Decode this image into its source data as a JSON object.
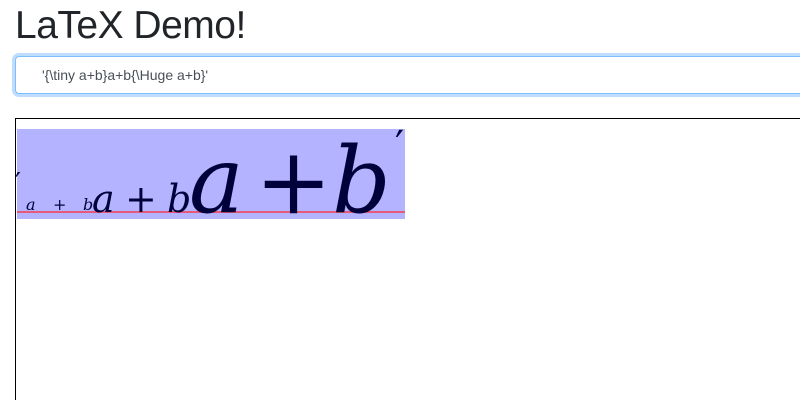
{
  "header": {
    "title": "LaTeX Demo!"
  },
  "editor": {
    "value": "'{\\tiny a+b}a+b{\\Huge a+b}'"
  },
  "render": {
    "highlight_color": "#b3b3ff",
    "baseline_color": "#e55a78",
    "glyph_color": "#00003a",
    "tiny": {
      "prime": "′",
      "a": "a",
      "plus": "+",
      "b": "b"
    },
    "normal": {
      "a": "a",
      "plus": "+",
      "b": "b"
    },
    "huge": {
      "a": "a",
      "plus": "+",
      "b": "b",
      "prime": "′"
    }
  }
}
